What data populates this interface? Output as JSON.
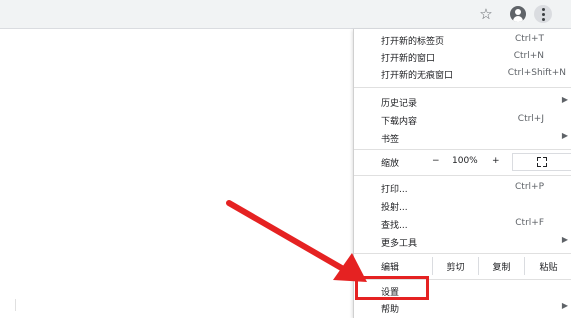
{
  "toolbar": {
    "icons": [
      "star-icon",
      "profile-icon",
      "more-vert-icon"
    ]
  },
  "menu": {
    "items_top": [
      {
        "label": "打开新的标签页",
        "shortcut": "Ctrl+T"
      },
      {
        "label": "打开新的窗口",
        "shortcut": "Ctrl+N"
      },
      {
        "label": "打开新的无痕窗口",
        "shortcut": "Ctrl+Shift+N"
      }
    ],
    "items_mid": [
      {
        "label": "历史记录",
        "shortcut": "",
        "submenu": true
      },
      {
        "label": "下载内容",
        "shortcut": "Ctrl+J",
        "submenu": false
      },
      {
        "label": "书签",
        "shortcut": "",
        "submenu": true
      }
    ],
    "zoom": {
      "label": "缩放",
      "minus": "−",
      "value": "100%",
      "plus": "+"
    },
    "items_tools": [
      {
        "label": "打印...",
        "shortcut": "Ctrl+P",
        "submenu": false
      },
      {
        "label": "投射...",
        "shortcut": "",
        "submenu": false
      },
      {
        "label": "查找...",
        "shortcut": "Ctrl+F",
        "submenu": false
      },
      {
        "label": "更多工具",
        "shortcut": "",
        "submenu": true
      }
    ],
    "edit": {
      "label": "编辑",
      "cut": "剪切",
      "copy": "复制",
      "paste": "粘贴"
    },
    "settings": {
      "label": "设置"
    },
    "help": {
      "label": "帮助"
    }
  },
  "colors": {
    "annotation": "#e52222",
    "menu_bg": "#ffffff",
    "toolbar_bg": "#f1f3f4"
  }
}
